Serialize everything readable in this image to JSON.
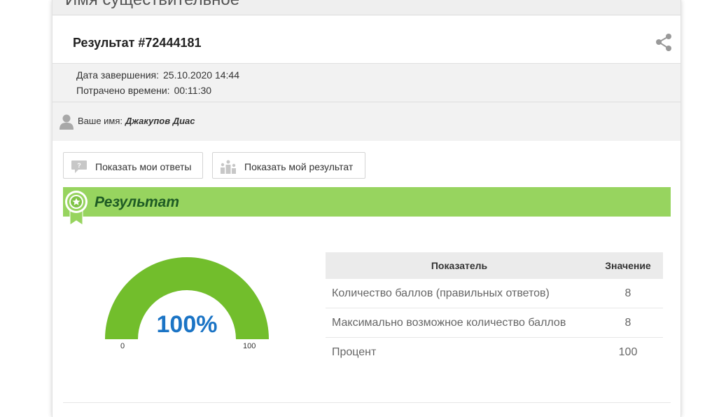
{
  "header": {
    "title": "Имя существительное"
  },
  "result": {
    "title": "Результат #72444181"
  },
  "meta": {
    "completed_label": "Дата завершения:",
    "completed_value": "25.10.2020 14:44",
    "time_label": "Потрачено времени:",
    "time_value": "00:11:30"
  },
  "user": {
    "label": "Ваше имя:",
    "name": "Джакупов Диас"
  },
  "buttons": {
    "show_answers": "Показать мои ответы",
    "show_result": "Показать мой результат"
  },
  "banner": {
    "title": "Результат"
  },
  "gauge": {
    "percent_text": "100%",
    "min": "0",
    "max": "100",
    "fraction": 1.0
  },
  "stats_table": {
    "col_indicator": "Показатель",
    "col_value": "Значение",
    "rows": [
      {
        "indicator": "Количество баллов (правильных ответов)",
        "value": "8"
      },
      {
        "indicator": "Максимально возможное количество баллов",
        "value": "8"
      },
      {
        "indicator": "Процент",
        "value": "100"
      }
    ]
  },
  "colors": {
    "banner_green": "#97d45f",
    "gauge_green": "#72be2c",
    "percent_blue": "#1b74c5",
    "banner_text": "#1e5b24"
  }
}
